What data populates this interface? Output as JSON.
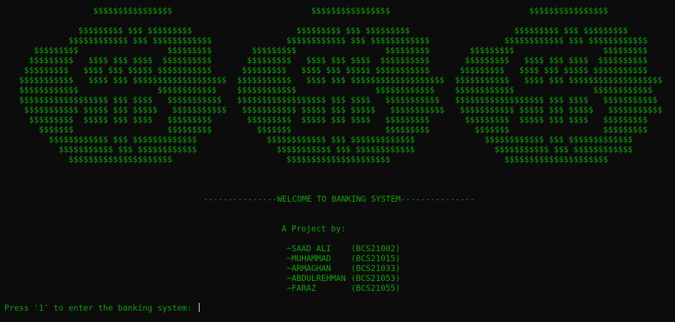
{
  "theme": {
    "background": "#0c0c0c",
    "text_color": "#13a10e",
    "cursor_color": "#e6e6e6"
  },
  "ascii_art": "               $$$$$$$$$$$$$$$$\n\n            $$$$$$$$$ $$$ $$$$$$$$$\n          $$$$$$$$$$$$ $$$ $$$$$$$$$$$$\n   $$$$$$$$$                  $$$$$$$$$\n  $$$$$$$$$   $$$$ $$$ $$$$  $$$$$$$$$$\n $$$$$$$$$   $$$$ $$$ $$$$$ $$$$$$$$$$$\n$$$$$$$$$$$   $$$$ $$$ $$$$$$$$$$$$$$$$$$$\n$$$$$$$$$$$$                $$$$$$$$$$$$\n$$$$$$$$$$$$$$$$$$ $$$ $$$$   $$$$$$$$$$$\n $$$$$$$$$$$ $$$$$ $$$ $$$$$   $$$$$$$$$$$\n  $$$$$$$$$  $$$$$ $$$ $$$$   $$$$$$$$$\n    $$$$$$$                   $$$$$$$$$\n      $$$$$$$$$$$$ $$$ $$$$$$$$$$$$$\n        $$$$$$$$$$$ $$$ $$$$$$$$$$$$\n          $$$$$$$$$$$$$$$$$$$$$",
  "welcome": {
    "line": "---------------WELCOME TO BANKING SYSTEM---------------"
  },
  "project": {
    "heading": "A Project by:",
    "members": [
      {
        "name": "~SAAD ALI",
        "id": "(BCS21002)"
      },
      {
        "name": "~MUHAMMAD",
        "id": "(BCS21015)"
      },
      {
        "name": "~ARMAGHAN",
        "id": "(BCS21033)"
      },
      {
        "name": "~ABDULREHMAN",
        "id": "(BCS21053)"
      },
      {
        "name": "~FARAZ",
        "id": "(BCS21055)"
      }
    ]
  },
  "prompt": {
    "text": "Press '1' to enter the banking system: ",
    "input_value": ""
  }
}
